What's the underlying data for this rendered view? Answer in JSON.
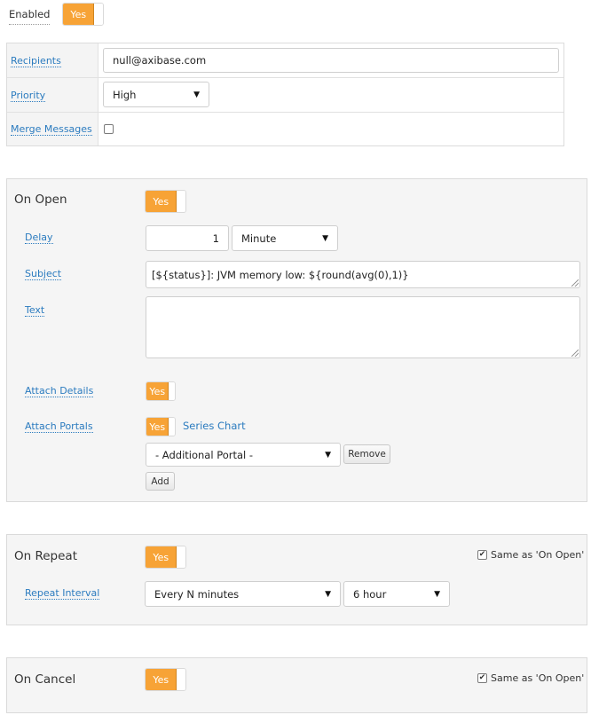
{
  "enabled": {
    "label": "Enabled",
    "toggle": "Yes"
  },
  "top": {
    "recipients_label": "Recipients",
    "recipients_value": "null@axibase.com",
    "priority_label": "Priority",
    "priority_value": "High",
    "merge_label": "Merge Messages"
  },
  "on_open": {
    "title": "On Open",
    "toggle": "Yes",
    "delay_label": "Delay",
    "delay_value": "1",
    "delay_unit": "Minute",
    "subject_label": "Subject",
    "subject_value": "[${status}]: JVM memory low: ${round(avg(0),1)}",
    "text_label": "Text",
    "text_value": "",
    "attach_details_label": "Attach Details",
    "attach_details_toggle": "Yes",
    "attach_portals_label": "Attach Portals",
    "attach_portals_toggle": "Yes",
    "portal_link": "Series Chart",
    "portal_select": "- Additional Portal -",
    "remove_button": "Remove",
    "add_button": "Add"
  },
  "on_repeat": {
    "title": "On Repeat",
    "toggle": "Yes",
    "same_as": "Same as 'On Open'",
    "interval_label": "Repeat Interval",
    "interval_mode": "Every N minutes",
    "interval_value": "6 hour"
  },
  "on_cancel": {
    "title": "On Cancel",
    "toggle": "Yes",
    "same_as": "Same as 'On Open'"
  }
}
